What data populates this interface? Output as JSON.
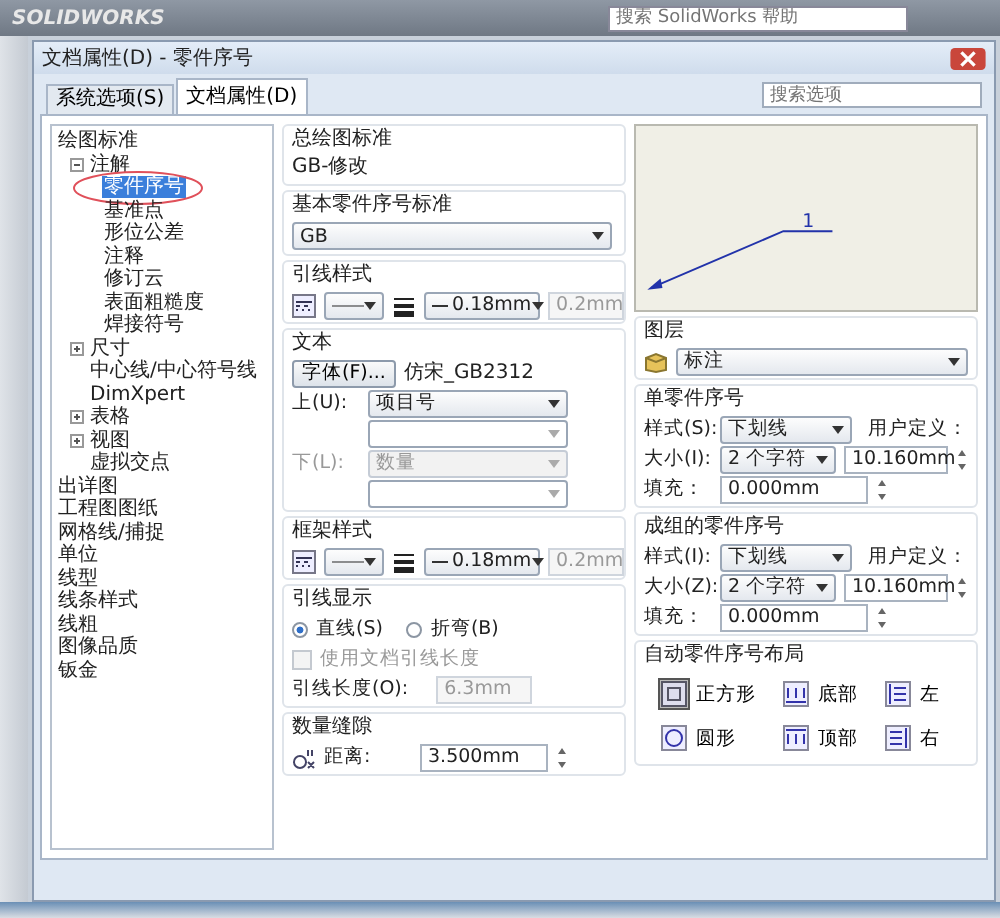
{
  "app": {
    "logo": "SOLIDWORKS",
    "help_search": {
      "placeholder": "搜索 SolidWorks 帮助"
    }
  },
  "dialog": {
    "title": "文档属性(D) - 零件序号"
  },
  "tabs": [
    {
      "label": "系统选项(S)",
      "selected": false
    },
    {
      "label": "文档属性(D)",
      "selected": true
    }
  ],
  "search": {
    "placeholder": "搜索选项"
  },
  "tree": [
    {
      "label": "绘图标准",
      "selected": false,
      "children": [
        {
          "label": "注解",
          "selected": false,
          "expanded": true,
          "children": [
            {
              "label": "零件序号",
              "selected": true,
              "circled": true
            },
            {
              "label": "基准点",
              "selected": false
            },
            {
              "label": "形位公差",
              "selected": false
            },
            {
              "label": "注释",
              "selected": false
            },
            {
              "label": "修订云",
              "selected": false
            },
            {
              "label": "表面粗糙度",
              "selected": false
            },
            {
              "label": "焊接符号",
              "selected": false
            }
          ]
        },
        {
          "label": "尺寸",
          "selected": false,
          "expanded": false
        },
        {
          "label": "中心线/中心符号线",
          "selected": false
        },
        {
          "label": "DimXpert",
          "selected": false
        },
        {
          "label": "表格",
          "selected": false,
          "expanded": false
        },
        {
          "label": "视图",
          "selected": false,
          "expanded": false
        },
        {
          "label": "虚拟交点",
          "selected": false
        }
      ]
    },
    {
      "label": "出详图",
      "selected": false
    },
    {
      "label": "工程图图纸",
      "selected": false
    },
    {
      "label": "网格线/捕捉",
      "selected": false
    },
    {
      "label": "单位",
      "selected": false
    },
    {
      "label": "线型",
      "selected": false
    },
    {
      "label": "线条样式",
      "selected": false
    },
    {
      "label": "线粗",
      "selected": false
    },
    {
      "label": "图像品质",
      "selected": false
    },
    {
      "label": "钣金",
      "selected": false
    }
  ],
  "overall_standard": {
    "title": "总绘图标准",
    "value": "GB-修改"
  },
  "base_standard": {
    "title": "基本零件序号标准",
    "value": "GB"
  },
  "leader_style": {
    "title": "引线样式",
    "thickness": "0.18mm",
    "custom": "0.2mm",
    "custom_disabled": true
  },
  "text": {
    "title": "文本",
    "font_button": "字体(F)...",
    "font": "仿宋_GB2312",
    "upper_label": "上(U):",
    "upper": "项目号",
    "lower_label": "下(L):",
    "lower": "数量",
    "lower_disabled": true
  },
  "frame_style": {
    "title": "框架样式",
    "thickness": "0.18mm",
    "custom": "0.2mm",
    "custom_disabled": true
  },
  "leader_display": {
    "title": "引线显示",
    "options": [
      {
        "label": "直线(S)",
        "selected": true
      },
      {
        "label": "折弯(B)",
        "selected": false
      }
    ],
    "use_doc_length": {
      "label": "使用文档引线长度",
      "checked": false,
      "disabled": true
    },
    "length_label": "引线长度(O):",
    "length": "6.3mm",
    "length_disabled": true
  },
  "quantity_gap": {
    "title": "数量缝隙",
    "label": "距离:",
    "value": "3.500mm"
  },
  "preview": {
    "number": "1"
  },
  "layer": {
    "title": "图层",
    "value": "标注"
  },
  "single": {
    "title": "单零件序号",
    "style_label": "样式(S):",
    "style": "下划线",
    "custom_label": "用户定义：",
    "size_label": "大小(I):",
    "size": "2 个字符",
    "custom": "10.160mm",
    "fill_label": "填充：",
    "fill": "0.000mm"
  },
  "stacked": {
    "title": "成组的零件序号",
    "style_label": "样式(I):",
    "style": "下划线",
    "custom_label": "用户定义：",
    "size_label": "大小(Z):",
    "size": "2 个字符",
    "custom": "10.160mm",
    "fill_label": "填充：",
    "fill": "0.000mm"
  },
  "layout": {
    "title": "自动零件序号布局",
    "options": [
      {
        "label": "正方形",
        "kind": "square",
        "selected": true
      },
      {
        "label": "底部",
        "kind": "bottom",
        "selected": false
      },
      {
        "label": "左",
        "kind": "left",
        "selected": false
      },
      {
        "label": "圆形",
        "kind": "circle",
        "selected": false
      },
      {
        "label": "顶部",
        "kind": "top",
        "selected": false
      },
      {
        "label": "右",
        "kind": "right",
        "selected": false
      }
    ]
  }
}
